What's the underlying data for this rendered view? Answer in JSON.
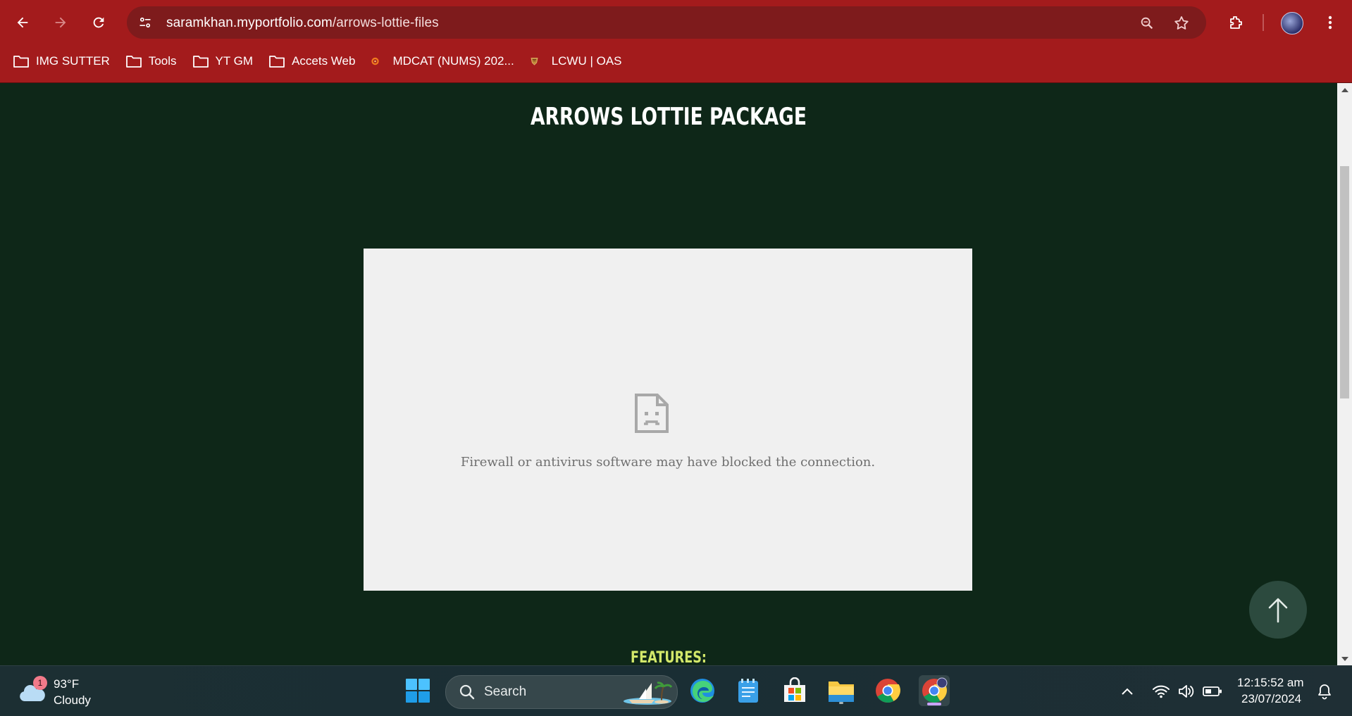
{
  "browser": {
    "url_host": "saramkhan.myportfolio.com",
    "url_path": "/arrows-lottie-files",
    "bookmarks": [
      {
        "label": "IMG SUTTER",
        "icon": "folder-icon"
      },
      {
        "label": "Tools",
        "icon": "folder-icon"
      },
      {
        "label": "YT GM",
        "icon": "folder-icon"
      },
      {
        "label": "Accets Web",
        "icon": "folder-icon"
      },
      {
        "label": "MDCAT (NUMS) 202...",
        "icon": "site-favicon"
      },
      {
        "label": "LCWU | OAS",
        "icon": "site-favicon"
      }
    ],
    "theme_color": "#a31b1c"
  },
  "page": {
    "title": "ARROWS LOTTIE PACKAGE",
    "embed_error": "Firewall or antivirus software may have blocked the connection.",
    "features_heading": "FEATURES:",
    "background_color": "#0e2718",
    "accent_color": "#d3e86a"
  },
  "taskbar": {
    "weather_badge": "1",
    "weather_temp": "93°F",
    "weather_condition": "Cloudy",
    "search_label": "Search",
    "clock_time": "12:15:52 am",
    "clock_date": "23/07/2024"
  }
}
